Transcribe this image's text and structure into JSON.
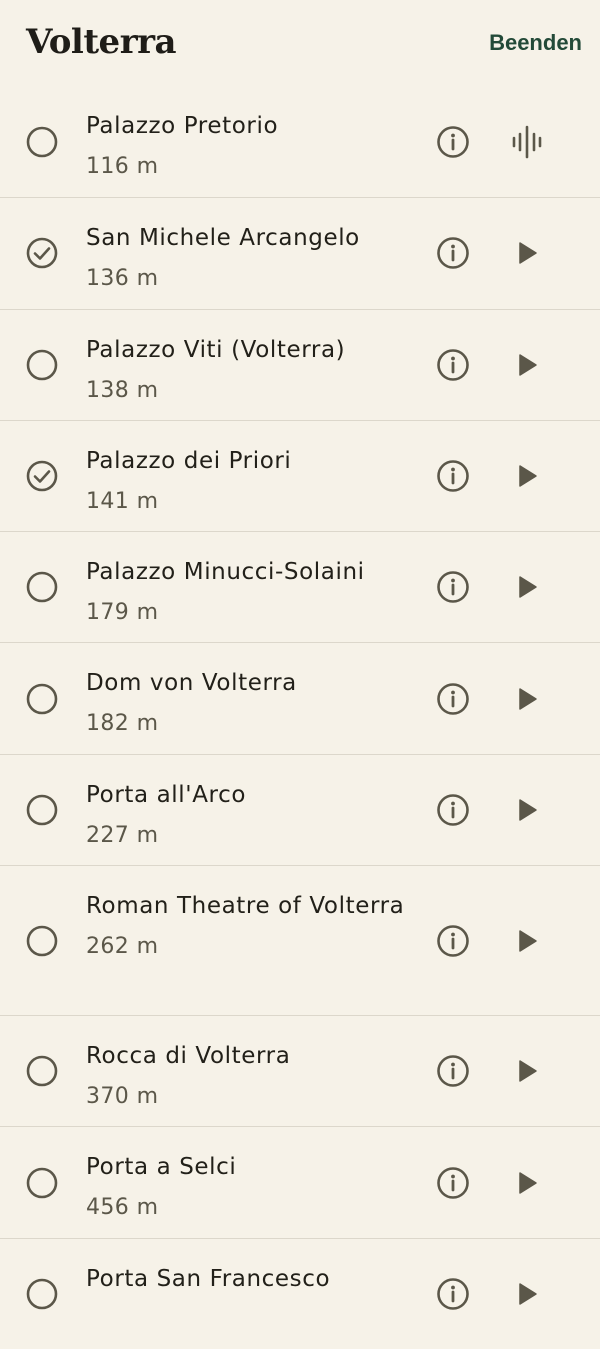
{
  "header": {
    "title": "Volterra",
    "end_label": "Beenden"
  },
  "colors": {
    "background": "#f6f2e8",
    "accent": "#234a38",
    "icon": "#5b5749",
    "divider": "#dcd7cb"
  },
  "sights": [
    {
      "name": "Palazzo Pretorio",
      "distance": "116 m",
      "visited": false,
      "action_icon": "audio-waveform-icon"
    },
    {
      "name": "San Michele Arcangelo",
      "distance": "136 m",
      "visited": true,
      "action_icon": "play-icon"
    },
    {
      "name": "Palazzo Viti (Volterra)",
      "distance": "138 m",
      "visited": false,
      "action_icon": "play-icon"
    },
    {
      "name": "Palazzo dei Priori",
      "distance": "141 m",
      "visited": true,
      "action_icon": "play-icon"
    },
    {
      "name": "Palazzo Minucci-Solaini",
      "distance": "179 m",
      "visited": false,
      "action_icon": "play-icon"
    },
    {
      "name": "Dom von Volterra",
      "distance": "182 m",
      "visited": false,
      "action_icon": "play-icon"
    },
    {
      "name": "Porta all'Arco",
      "distance": "227 m",
      "visited": false,
      "action_icon": "play-icon"
    },
    {
      "name": "Roman Theatre of Volterra",
      "distance": "262 m",
      "visited": false,
      "action_icon": "play-icon"
    },
    {
      "name": "Rocca di Volterra",
      "distance": "370 m",
      "visited": false,
      "action_icon": "play-icon"
    },
    {
      "name": "Porta a Selci",
      "distance": "456 m",
      "visited": false,
      "action_icon": "play-icon"
    },
    {
      "name": "Porta San Francesco",
      "distance": "",
      "visited": false,
      "action_icon": "play-icon"
    }
  ]
}
